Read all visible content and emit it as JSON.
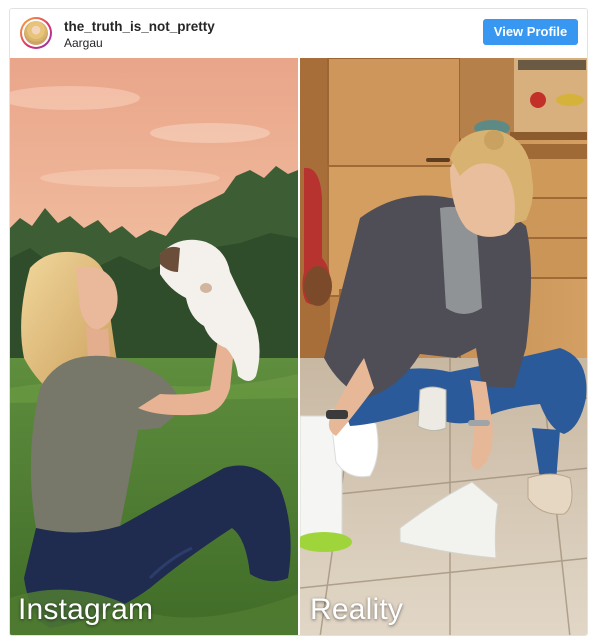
{
  "post": {
    "username": "the_truth_is_not_pretty",
    "location": "Aargau",
    "view_profile_label": "View Profile",
    "avatar_icon": "profile-avatar"
  },
  "comparison": {
    "left_caption": "Instagram",
    "right_caption": "Reality"
  },
  "colors": {
    "button_blue": "#3897f0",
    "username_text": "#262626"
  }
}
